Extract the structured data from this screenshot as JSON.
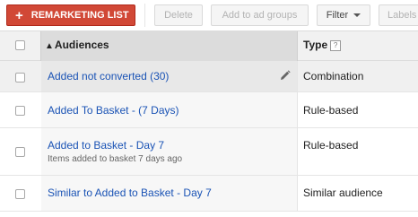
{
  "toolbar": {
    "remarketing_label": "REMARKETING LIST",
    "delete_label": "Delete",
    "add_groups_label": "Add to ad groups",
    "filter_label": "Filter",
    "labels_label": "Labels"
  },
  "table": {
    "columns": {
      "audiences": "Audiences",
      "type": "Type",
      "help": "?"
    },
    "rows": [
      {
        "name": "Added not converted (30)",
        "subtitle": "",
        "type": "Combination"
      },
      {
        "name": "Added To Basket - (7 Days)",
        "subtitle": "",
        "type": "Rule-based"
      },
      {
        "name": "Added to Basket - Day 7",
        "subtitle": "Items added to basket 7 days ago",
        "type": "Rule-based"
      },
      {
        "name": "Similar to Added to Basket - Day 7",
        "subtitle": "",
        "type": "Similar audience"
      }
    ]
  },
  "colors": {
    "primary": "#d14836",
    "link": "#1a53b5",
    "sorted_header": "#dcdcdc"
  },
  "icons": {
    "add": "plus-icon",
    "sort": "sort-up-icon",
    "edit": "pencil-icon",
    "help": "help-icon",
    "dropdown": "caret-down-icon"
  }
}
